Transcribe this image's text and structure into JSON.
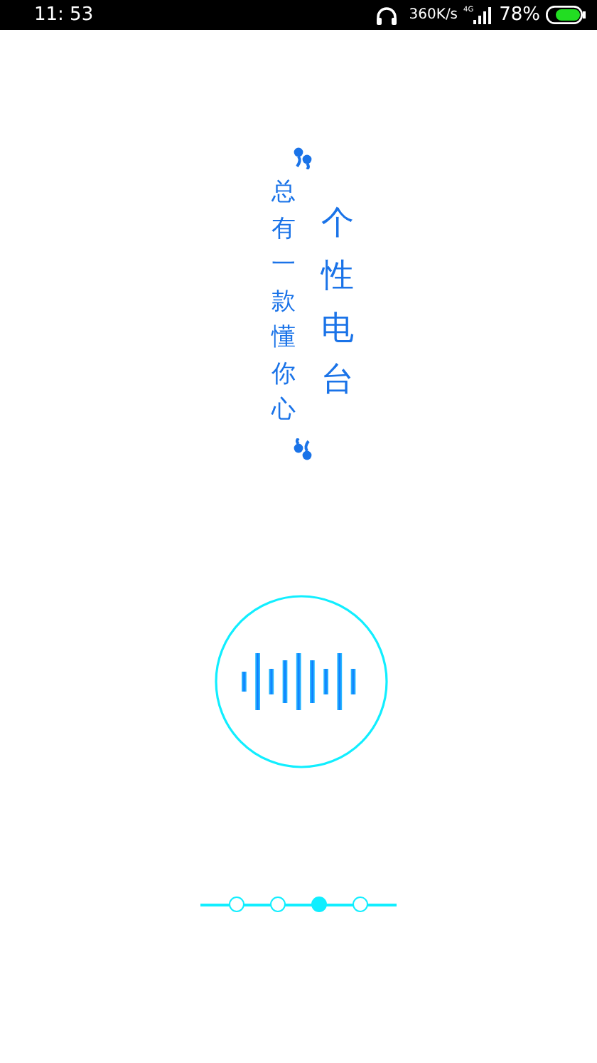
{
  "status_bar": {
    "time": "11: 53",
    "speed": "360K/s",
    "network": "4G",
    "battery": "78%"
  },
  "slogan": {
    "line_1": "总有一款懂你心",
    "line_2": "个性电台"
  },
  "pager": [
    {
      "selected": false
    },
    {
      "selected": false
    },
    {
      "selected": true
    },
    {
      "selected": false
    }
  ]
}
